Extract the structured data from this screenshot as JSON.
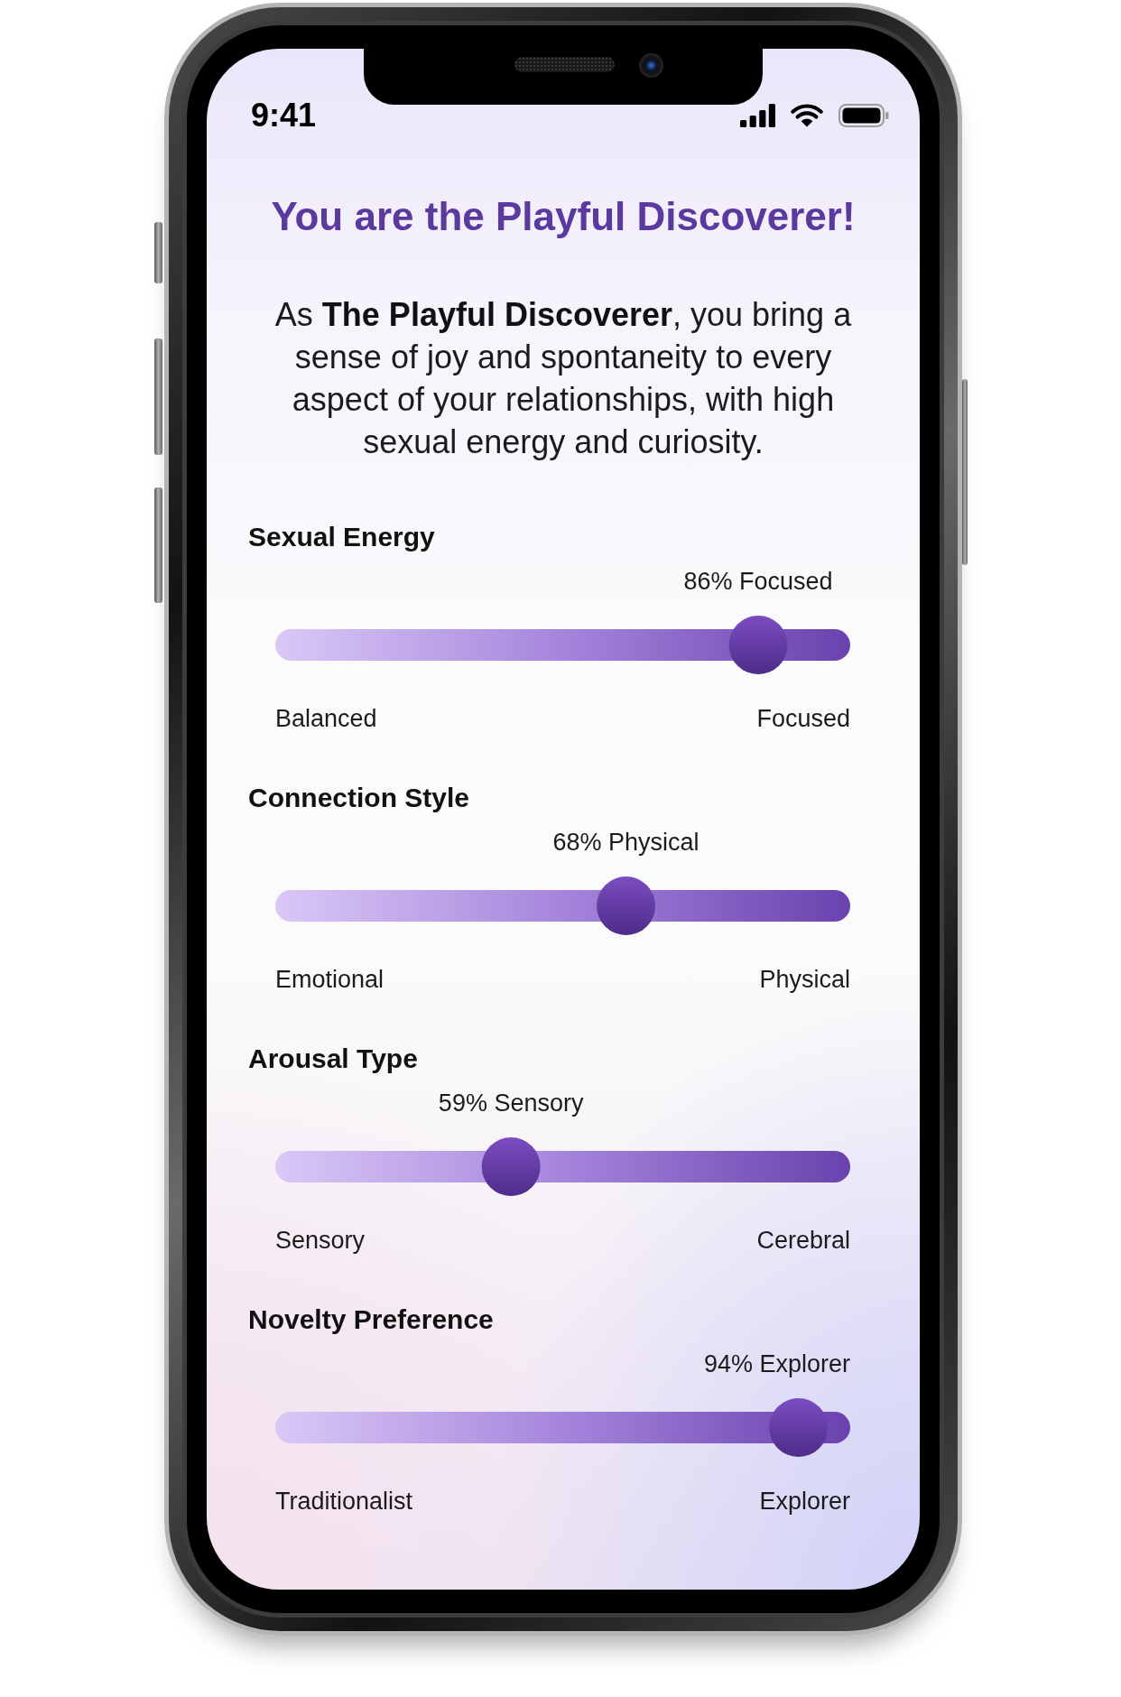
{
  "status_bar": {
    "time": "9:41"
  },
  "title": "You are the Playful Discoverer!",
  "description": "As **The Playful Discoverer**, you bring a sense of joy and spontaneity to every aspect of your relationships, with high sexual energy and curiosity.",
  "sliders": [
    {
      "label": "Sexual Energy",
      "reading": "86% Focused",
      "level": 0.84,
      "min_label": "Balanced",
      "max_label": "Focused"
    },
    {
      "label": "Connection Style",
      "reading": "68% Physical",
      "level": 0.61,
      "min_label": "Emotional",
      "max_label": "Physical"
    },
    {
      "label": "Arousal Type",
      "reading": "59% Sensory",
      "level": 0.41,
      "min_label": "Sensory",
      "max_label": "Cerebral"
    },
    {
      "label": "Novelty Preference",
      "reading": "94% Explorer",
      "level": 0.91,
      "min_label": "Traditionalist",
      "max_label": "Explorer"
    }
  ]
}
